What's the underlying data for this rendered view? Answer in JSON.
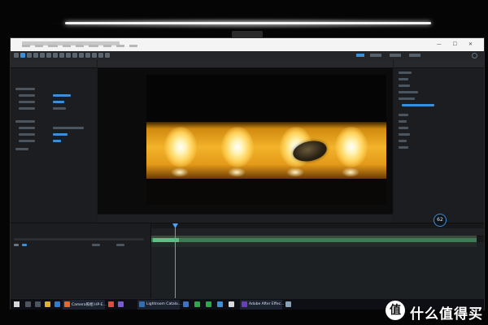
{
  "window": {
    "title": "",
    "menu": [
      "",
      "",
      "",
      "",
      "",
      "",
      "",
      "",
      ""
    ]
  },
  "viewer": {
    "tab_label": "",
    "zoom": "",
    "time": "",
    "resolution": ""
  },
  "timeline": {
    "comp_name": "",
    "current_time": "",
    "layer_name": "",
    "ruler_ticks": [
      "",
      "",
      "",
      "",
      "",
      "",
      "",
      "",
      "",
      "",
      "",
      "",
      "",
      "",
      ""
    ],
    "playhead_fraction": 0.07
  },
  "project_panel": {
    "title": "",
    "tabs": [
      "",
      ""
    ],
    "layer_label": ""
  },
  "effects_panel": {
    "title": "",
    "items": [
      "",
      "",
      "",
      "",
      "",
      "",
      "",
      "",
      "",
      "",
      "",
      ""
    ]
  },
  "badge": {
    "value": "62"
  },
  "taskbar": {
    "apps": [
      {
        "label": "Camera照相 HP-E...",
        "color": "#e8672c"
      },
      {
        "label": "Lightroom Catalo...",
        "color": "#2f6fb5"
      },
      {
        "label": "Adobe After Effec...",
        "color": "#6a3fb8"
      }
    ],
    "clock_time": "",
    "clock_date": ""
  },
  "watermark": {
    "glyph": "值",
    "text": "什么值得买"
  },
  "colors": {
    "accent": "#3b8fd9",
    "layer_green": "#5bbf88",
    "glow": "#f3b32a"
  }
}
